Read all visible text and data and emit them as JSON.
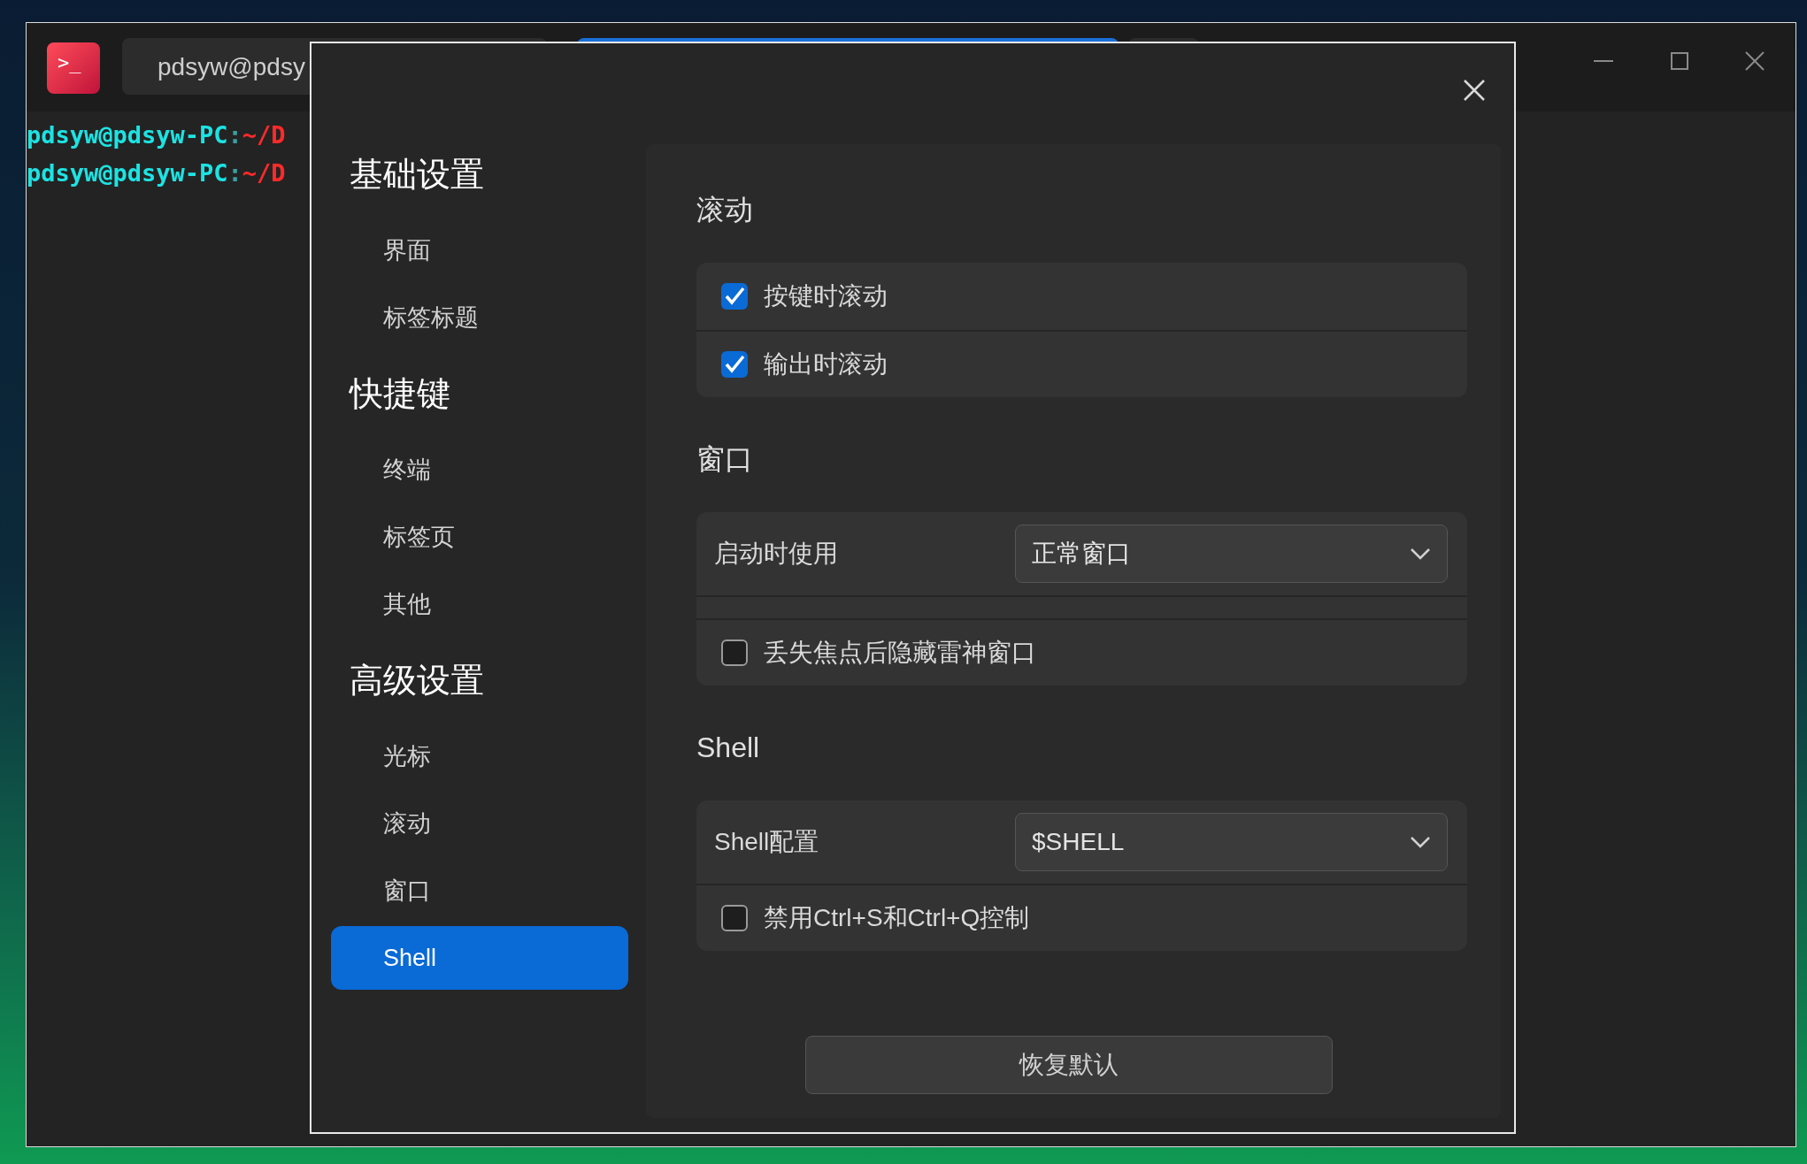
{
  "terminal": {
    "app_icon": ">_",
    "tabs": [
      {
        "label": "pdsyw@pdsy",
        "selected": false
      },
      {
        "selected": true
      },
      {
        "selected": false
      }
    ],
    "lines": [
      {
        "user_host": "pdsyw@pdsyw-PC",
        "separator": ":",
        "path": "~/D"
      },
      {
        "user_host": "pdsyw@pdsyw-PC",
        "separator": ":",
        "path": "~/D"
      }
    ]
  },
  "settings_dialog": {
    "sidebar": [
      {
        "title": "基础设置",
        "items": [
          {
            "label": "界面",
            "selected": false
          },
          {
            "label": "标签标题",
            "selected": false
          }
        ]
      },
      {
        "title": "快捷键",
        "items": [
          {
            "label": "终端",
            "selected": false
          },
          {
            "label": "标签页",
            "selected": false
          },
          {
            "label": "其他",
            "selected": false
          }
        ]
      },
      {
        "title": "高级设置",
        "items": [
          {
            "label": "光标",
            "selected": false
          },
          {
            "label": "滚动",
            "selected": false
          },
          {
            "label": "窗口",
            "selected": false
          },
          {
            "label": "Shell",
            "selected": true
          }
        ]
      }
    ],
    "sections": [
      {
        "title": "滚动",
        "rows": [
          {
            "kind": "checkbox",
            "label": "按键时滚动",
            "checked": true
          },
          {
            "kind": "checkbox",
            "label": "输出时滚动",
            "checked": true
          }
        ]
      },
      {
        "title": "窗口",
        "rows": [
          {
            "kind": "select",
            "label": "启动时使用",
            "value": "正常窗口"
          },
          {
            "kind": "spacer"
          },
          {
            "kind": "checkbox",
            "label": "丢失焦点后隐藏雷神窗口",
            "checked": false
          }
        ]
      },
      {
        "title": "Shell",
        "rows": [
          {
            "kind": "select",
            "label": "Shell配置",
            "value": "$SHELL"
          },
          {
            "kind": "checkbox",
            "label": "禁用Ctrl+S和Ctrl+Q控制",
            "checked": false
          }
        ]
      }
    ],
    "restore_button": "恢复默认"
  }
}
